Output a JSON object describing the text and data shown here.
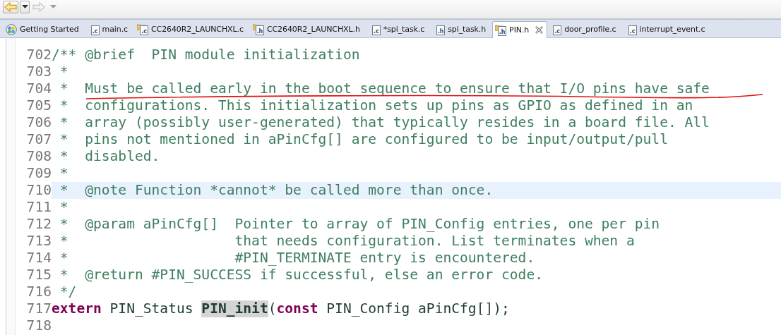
{
  "toolbar": {
    "buttons": [
      {
        "kind": "back",
        "disabled": false
      },
      {
        "kind": "dropdown",
        "disabled": false
      },
      {
        "kind": "forward",
        "disabled": true
      },
      {
        "kind": "dropdown",
        "disabled": true
      }
    ]
  },
  "tabs": [
    {
      "label": "Getting Started",
      "kind": "welcome",
      "selected": false
    },
    {
      "label": "main.c",
      "kind": "file",
      "icon_label": ".c",
      "linked": false,
      "selected": false
    },
    {
      "label": "CC2640R2_LAUNCHXL.c",
      "kind": "file",
      "icon_label": ".c",
      "linked": true,
      "selected": false
    },
    {
      "label": "CC2640R2_LAUNCHXL.h",
      "kind": "file",
      "icon_label": ".h",
      "linked": true,
      "selected": false
    },
    {
      "label": "*spi_task.c",
      "kind": "file",
      "icon_label": ".c",
      "linked": false,
      "selected": false
    },
    {
      "label": "spi_task.h",
      "kind": "file",
      "icon_label": ".h",
      "linked": false,
      "selected": false
    },
    {
      "label": "PIN.h",
      "kind": "file",
      "icon_label": ".h",
      "linked": true,
      "selected": true
    },
    {
      "label": "door_profile.c",
      "kind": "file",
      "icon_label": ".c",
      "linked": false,
      "selected": false
    },
    {
      "label": "interrupt_event.c",
      "kind": "file",
      "icon_label": ".c",
      "linked": false,
      "selected": false
    }
  ],
  "editor": {
    "lines": [
      {
        "number": "702",
        "current": false,
        "underlined": false,
        "tokens": [
          {
            "kind": "comment",
            "text": "/** @brief  PIN module initialization"
          }
        ]
      },
      {
        "number": "703",
        "current": false,
        "underlined": false,
        "tokens": [
          {
            "kind": "comment",
            "text": " *"
          }
        ]
      },
      {
        "number": "704",
        "current": false,
        "underlined": true,
        "tokens": [
          {
            "kind": "comment",
            "text": " *  Must be called early in the boot sequence to ensure that I/O pins have safe"
          }
        ]
      },
      {
        "number": "705",
        "current": false,
        "underlined": false,
        "tokens": [
          {
            "kind": "comment",
            "text": " *  configurations. This initialization sets up pins as GPIO as defined in an"
          }
        ]
      },
      {
        "number": "706",
        "current": false,
        "underlined": false,
        "tokens": [
          {
            "kind": "comment",
            "text": " *  array (possibly user-generated) that typically resides in a board file. All"
          }
        ]
      },
      {
        "number": "707",
        "current": false,
        "underlined": false,
        "tokens": [
          {
            "kind": "comment",
            "text": " *  pins not mentioned in aPinCfg[] are configured to be input/output/pull"
          }
        ]
      },
      {
        "number": "708",
        "current": false,
        "underlined": false,
        "tokens": [
          {
            "kind": "comment",
            "text": " *  disabled."
          }
        ]
      },
      {
        "number": "709",
        "current": false,
        "underlined": false,
        "tokens": [
          {
            "kind": "comment",
            "text": " *"
          }
        ]
      },
      {
        "number": "710",
        "current": true,
        "underlined": false,
        "tokens": [
          {
            "kind": "comment",
            "text": " *  @note Function *cannot* be called more than once."
          }
        ]
      },
      {
        "number": "711",
        "current": false,
        "underlined": false,
        "tokens": [
          {
            "kind": "comment",
            "text": " *"
          }
        ]
      },
      {
        "number": "712",
        "current": false,
        "underlined": false,
        "tokens": [
          {
            "kind": "comment",
            "text": " *  @param aPinCfg[]  Pointer to array of PIN_Config entries, one per pin"
          }
        ]
      },
      {
        "number": "713",
        "current": false,
        "underlined": false,
        "tokens": [
          {
            "kind": "comment",
            "text": " *                    that needs configuration. List terminates when a"
          }
        ]
      },
      {
        "number": "714",
        "current": false,
        "underlined": false,
        "tokens": [
          {
            "kind": "comment",
            "text": " *                    #PIN_TERMINATE entry is encountered."
          }
        ]
      },
      {
        "number": "715",
        "current": false,
        "underlined": false,
        "tokens": [
          {
            "kind": "comment",
            "text": " *  @return #PIN_SUCCESS if successful, else an error code."
          }
        ]
      },
      {
        "number": "716",
        "current": false,
        "underlined": false,
        "tokens": [
          {
            "kind": "comment",
            "text": " */"
          }
        ]
      },
      {
        "number": "717",
        "current": false,
        "underlined": false,
        "tokens": [
          {
            "kind": "keyword",
            "text": "extern"
          },
          {
            "kind": "plain",
            "text": " PIN_Status "
          },
          {
            "kind": "occurrence",
            "text": "PIN_init"
          },
          {
            "kind": "plain",
            "text": "("
          },
          {
            "kind": "keyword",
            "text": "const"
          },
          {
            "kind": "plain",
            "text": " PIN_Config aPinCfg[]);"
          }
        ]
      },
      {
        "number": "718",
        "current": false,
        "underlined": false
      }
    ]
  }
}
